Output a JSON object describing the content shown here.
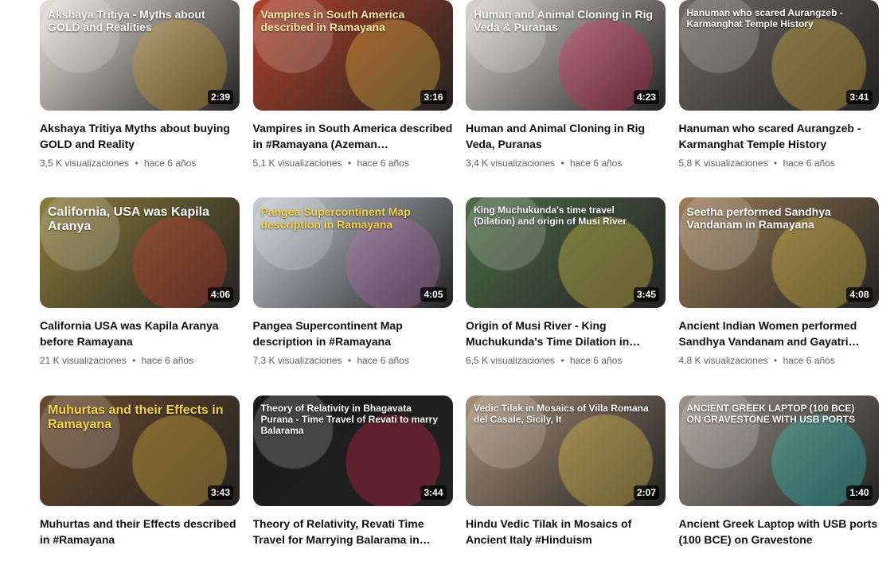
{
  "videos": [
    {
      "title": "Akshaya Tritiya Myths about buying GOLD and Reality",
      "duration": "2:39",
      "views": "3,5 K visualizaciones",
      "age": "hace 6 años",
      "overlay": "Akshaya Tritiya - Myths about GOLD and Realities",
      "bg": "#e9e4dc",
      "accent": "#d6a02a",
      "text_color": "#ffffff"
    },
    {
      "title": "Vampires in South America described in #Ramayana (Azeman…",
      "duration": "3:16",
      "views": "5,1 K visualizaciones",
      "age": "hace 6 años",
      "overlay": "Vampires in South America described in Ramayana",
      "bg": "#b0422a",
      "accent": "#f3c341",
      "text_color": "#fde9a6"
    },
    {
      "title": "Human and Animal Cloning in Rig Veda, Puranas",
      "duration": "4:23",
      "views": "3,4 K visualizaciones",
      "age": "hace 6 años",
      "overlay": "Human and Animal Cloning in Rig Veda & Puranas",
      "bg": "#d8d6d2",
      "accent": "#e0244f",
      "text_color": "#ffffff"
    },
    {
      "title": "Hanuman who scared Aurangzeb - Karmanghat Temple History",
      "duration": "3:41",
      "views": "5,8 K visualizaciones",
      "age": "hace 6 años",
      "overlay": "Hanuman who scared Aurangzeb - Karmanghat Temple History",
      "bg": "#6e6a64",
      "accent": "#f3c341",
      "text_color": "#ffffff"
    },
    {
      "title": "California USA was Kapila Aranya before Ramayana",
      "duration": "4:06",
      "views": "21 K visualizaciones",
      "age": "hace 6 años",
      "overlay": "California, USA was Kapila Aranya",
      "bg": "#8b7d3a",
      "accent": "#d43a2c",
      "text_color": "#ffffff"
    },
    {
      "title": "Pangea Supercontinent Map description in #Ramayana",
      "duration": "4:05",
      "views": "7,3 K visualizaciones",
      "age": "hace 6 años",
      "overlay": "Pangea Supercontinent Map description in Ramayana",
      "bg": "#c8cfd6",
      "accent": "#b96bb0",
      "text_color": "#f3d34a"
    },
    {
      "title": "Origin of Musi River - King Muchukunda's Time Dilation in…",
      "duration": "3:45",
      "views": "6,5 K visualizaciones",
      "age": "hace 6 años",
      "overlay": "King Muchukunda's time travel (Dilation) and origin of Musi River",
      "bg": "#4f6b49",
      "accent": "#f3d34a",
      "text_color": "#ffffff"
    },
    {
      "title": "Ancient Indian Women performed Sandhya Vandanam and Gayatri…",
      "duration": "4:08",
      "views": "4,8 K visualizaciones",
      "age": "hace 6 años",
      "overlay": "Seetha performed Sandhya Vandanam in Ramayana",
      "bg": "#9c7d57",
      "accent": "#f3d34a",
      "text_color": "#ffffff"
    },
    {
      "title": "Muhurtas and their Effects described in #Ramayana",
      "duration": "3:43",
      "views": "",
      "age": "",
      "overlay": "Muhurtas and their Effects in Ramayana",
      "bg": "#6b4a2c",
      "accent": "#f3c341",
      "text_color": "#f3d34a"
    },
    {
      "title": "Theory of Relativity, Revati Time Travel for Marrying Balarama in…",
      "duration": "3:44",
      "views": "",
      "age": "",
      "overlay": "Theory of Relativity in Bhagavata Purana - Time Travel of Revati to marry Balarama",
      "bg": "#1a1a1a",
      "accent": "#e0244f",
      "text_color": "#ffffff"
    },
    {
      "title": "Hindu Vedic Tilak in Mosaics of Ancient Italy #Hinduism",
      "duration": "2:07",
      "views": "",
      "age": "",
      "overlay": "Vedic Tilak in Mosaics of Villa Romana del Casale, Sicily, It",
      "bg": "#a88f78",
      "accent": "#f3d34a",
      "text_color": "#ffffff"
    },
    {
      "title": "Ancient Greek Laptop with USB ports (100 BCE) on Gravestone",
      "duration": "1:40",
      "views": "",
      "age": "",
      "overlay": "ANCIENT GREEK LAPTOP (100 BCE) ON GRAVESTONE WITH USB PORTS",
      "bg": "#9b9488",
      "accent": "#2bd1c9",
      "text_color": "#ffffff"
    }
  ]
}
